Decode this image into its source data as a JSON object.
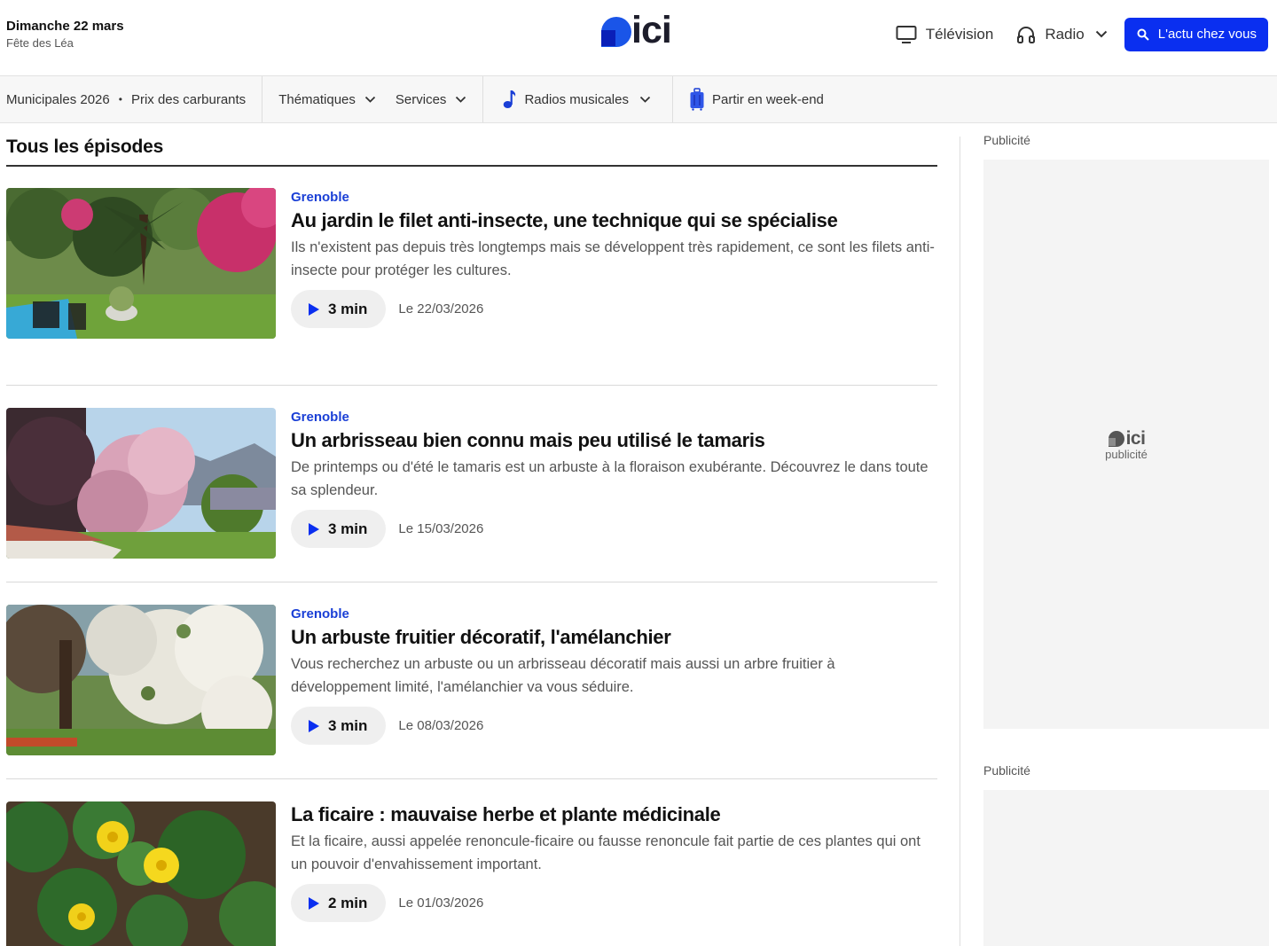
{
  "header": {
    "date": "Dimanche 22 mars",
    "saint": "Fête des Léa",
    "logo_text": "ici",
    "nav": {
      "television": "Télévision",
      "radio": "Radio",
      "cta": "L'actu chez vous"
    }
  },
  "subnav": {
    "municipales": "Municipales 2026",
    "carburants": "Prix des carburants",
    "thematiques": "Thématiques",
    "services": "Services",
    "radios": "Radios musicales",
    "weekend": "Partir en week-end"
  },
  "main": {
    "section_title": "Tous les épisodes",
    "episodes": [
      {
        "tag": "Grenoble",
        "title": "Au jardin le filet anti-insecte, une technique qui se spécialise",
        "desc": "Ils n'existent pas depuis très longtemps mais se développent très rapidement, ce sont les filets anti-insecte pour protéger les cultures.",
        "duration": "3 min",
        "date": "Le 22/03/2026"
      },
      {
        "tag": "Grenoble",
        "title": "Un arbrisseau bien connu mais peu utilisé le tamaris",
        "desc": "De printemps ou d'été le tamaris est un arbuste à la floraison exubérante. Découvrez le dans toute sa splendeur.",
        "duration": "3 min",
        "date": "Le 15/03/2026"
      },
      {
        "tag": "Grenoble",
        "title": "Un arbuste fruitier décoratif, l'amélanchier",
        "desc": "Vous recherchez un arbuste ou un arbrisseau décoratif mais aussi un arbre fruitier à développement limité, l'amélanchier va vous séduire.",
        "duration": "3 min",
        "date": "Le 08/03/2026"
      },
      {
        "tag": "",
        "title": "La ficaire : mauvaise herbe et plante médicinale",
        "desc": "Et la ficaire, aussi appelée renoncule-ficaire ou fausse renoncule fait partie de ces plantes qui ont un pouvoir d'envahissement important.",
        "duration": "2 min",
        "date": "Le 01/03/2026"
      }
    ]
  },
  "sidebar": {
    "ad_label_1": "Publicité",
    "ad_label_2": "Publicité",
    "ad_logo_text": "ici",
    "ad_logo_sub": "publicité"
  },
  "colors": {
    "brand_blue": "#0a2ff0",
    "tag_blue": "#1a3fd6"
  }
}
